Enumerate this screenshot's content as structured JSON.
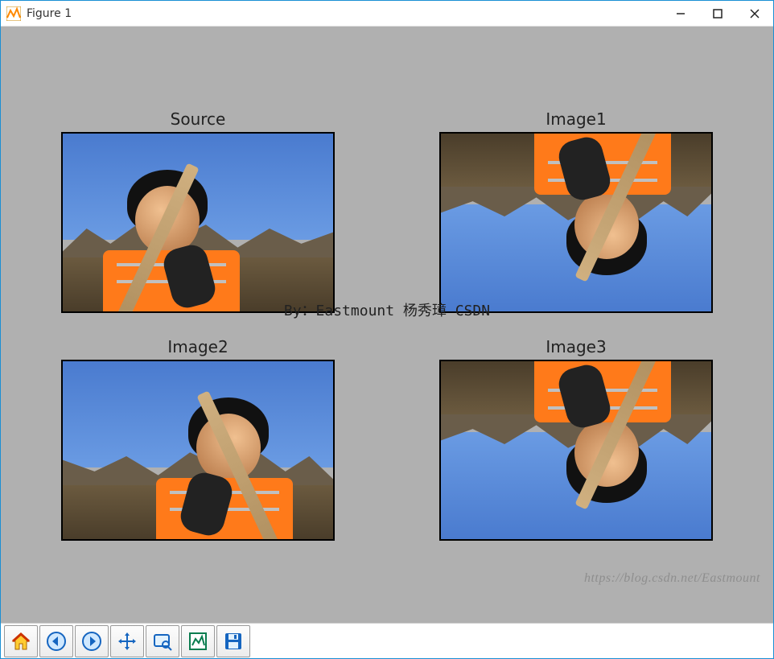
{
  "window": {
    "title": "Figure 1"
  },
  "subplots": [
    {
      "title": "Source"
    },
    {
      "title": "Image1"
    },
    {
      "title": "Image2"
    },
    {
      "title": "Image3"
    }
  ],
  "suptitle": "By：Eastmount 杨秀璋 CSDN",
  "watermark": "https://blog.csdn.net/Eastmount",
  "toolbar": {
    "home": "Home",
    "back": "Back",
    "forward": "Forward",
    "pan": "Pan",
    "zoom": "Zoom",
    "subplots": "Configure subplots",
    "save": "Save"
  },
  "win_controls": {
    "minimize": "Minimize",
    "maximize": "Maximize",
    "close": "Close"
  }
}
